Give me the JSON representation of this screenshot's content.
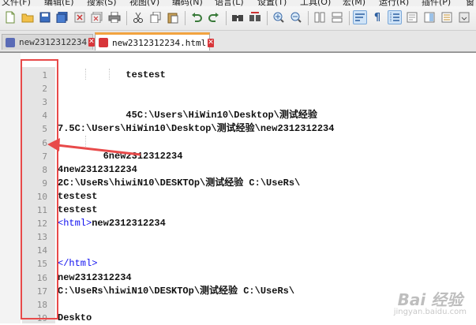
{
  "menu": [
    "文件(F)",
    "编辑(E)",
    "搜索(S)",
    "视图(V)",
    "编码(N)",
    "语言(L)",
    "设置(T)",
    "工具(O)",
    "宏(M)",
    "运行(R)",
    "插件(P)",
    "窗"
  ],
  "tabs": [
    {
      "label": "new2312312234",
      "close": "✕"
    },
    {
      "label": "new2312312234.html",
      "close": "✕"
    }
  ],
  "editor": {
    "line_numbers": [
      "1",
      "2",
      "3",
      "4",
      "5",
      "6",
      "7",
      "8",
      "9",
      "10",
      "11",
      "12",
      "13",
      "14",
      "15",
      "16",
      "17",
      "18",
      "19"
    ],
    "lines": [
      {
        "n": 1,
        "pre": "",
        "tag": "",
        "post": "            testest"
      },
      {
        "n": 2,
        "pre": "",
        "tag": "",
        "post": ""
      },
      {
        "n": 3,
        "pre": "",
        "tag": "",
        "post": ""
      },
      {
        "n": 4,
        "pre": "",
        "tag": "",
        "post": "            45C:\\Users\\HiWin10\\Desktop\\测试经验"
      },
      {
        "n": 5,
        "pre": "",
        "tag": "",
        "post": "7.5C:\\Users\\HiWin10\\Desktop\\测试经验\\new2312312234"
      },
      {
        "n": 6,
        "pre": "",
        "tag": "",
        "post": ""
      },
      {
        "n": 7,
        "pre": "",
        "tag": "",
        "post": "        6new2312312234"
      },
      {
        "n": 8,
        "pre": "",
        "tag": "",
        "post": "4new2312312234"
      },
      {
        "n": 9,
        "pre": "",
        "tag": "",
        "post": "2C:\\UseRs\\hiwiN10\\DESKTOp\\测试经验 C:\\UseRs\\"
      },
      {
        "n": 10,
        "pre": "",
        "tag": "",
        "post": "testest"
      },
      {
        "n": 11,
        "pre": "",
        "tag": "",
        "post": "testest"
      },
      {
        "n": 12,
        "pre": "",
        "tag": "<html>",
        "post": "new2312312234"
      },
      {
        "n": 13,
        "pre": "",
        "tag": "",
        "post": ""
      },
      {
        "n": 14,
        "pre": "",
        "tag": "",
        "post": ""
      },
      {
        "n": 15,
        "pre": "",
        "tag": "</html>",
        "post": ""
      },
      {
        "n": 16,
        "pre": "",
        "tag": "",
        "post": "new2312312234"
      },
      {
        "n": 17,
        "pre": "",
        "tag": "",
        "post": "C:\\UseRs\\hiwiN10\\DESKTOp\\测试经验 C:\\UseRs\\"
      },
      {
        "n": 18,
        "pre": "",
        "tag": "",
        "post": ""
      },
      {
        "n": 19,
        "pre": "",
        "tag": "",
        "post": "Deskto"
      }
    ]
  },
  "toolbar_icons": [
    "new-file-icon",
    "open-icon",
    "save-icon",
    "save-all-icon",
    "close-icon",
    "close-all-icon",
    "print-icon",
    "cut-icon",
    "copy-icon",
    "paste-icon",
    "undo-icon",
    "redo-icon",
    "find-icon",
    "replace-icon",
    "zoom-in-icon",
    "zoom-out-icon",
    "sync-v-icon",
    "sync-h-icon",
    "word-wrap-icon",
    "show-all-chars-icon",
    "indent-guide-icon",
    "lang-icon",
    "doc-map-icon",
    "function-list-icon"
  ],
  "watermark": {
    "logo": "Bai 经验",
    "url": "jingyan.baidu.com"
  }
}
